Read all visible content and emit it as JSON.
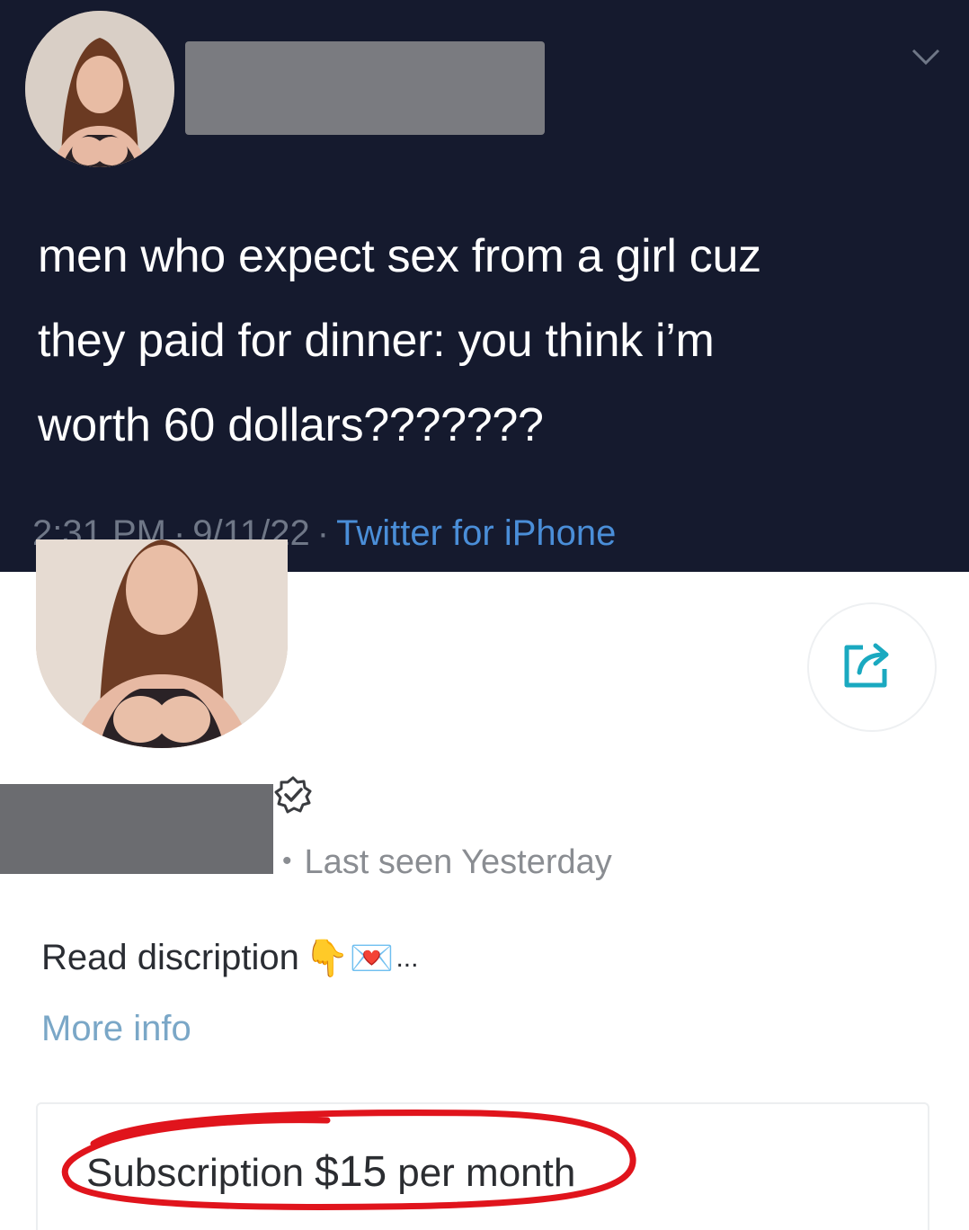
{
  "tweet": {
    "text_lines": [
      "men who expect sex from a girl cuz",
      "they paid for dinner: you think i’m",
      "worth 60 dollars???????"
    ],
    "time": "2:31 PM",
    "date": "9/11/22",
    "source": "Twitter for iPhone",
    "separator": "·"
  },
  "profile": {
    "last_seen": "Last seen Yesterday",
    "separator": "•",
    "description": "Read discription",
    "description_emojis": "👇💌",
    "ellipsis": "...",
    "more_info": "More info",
    "subscription": {
      "label": "Subscription",
      "price": "$15",
      "period": "per month"
    }
  },
  "colors": {
    "tweet_background": "#151a2e",
    "link_blue": "#4a8ed8",
    "more_info": "#7aa7c7",
    "highlight_red": "#e0141c",
    "share_teal": "#1aa9c0"
  },
  "icons": {
    "caret": "chevron-down-icon",
    "share": "share-icon",
    "verified": "verified-badge-icon"
  }
}
